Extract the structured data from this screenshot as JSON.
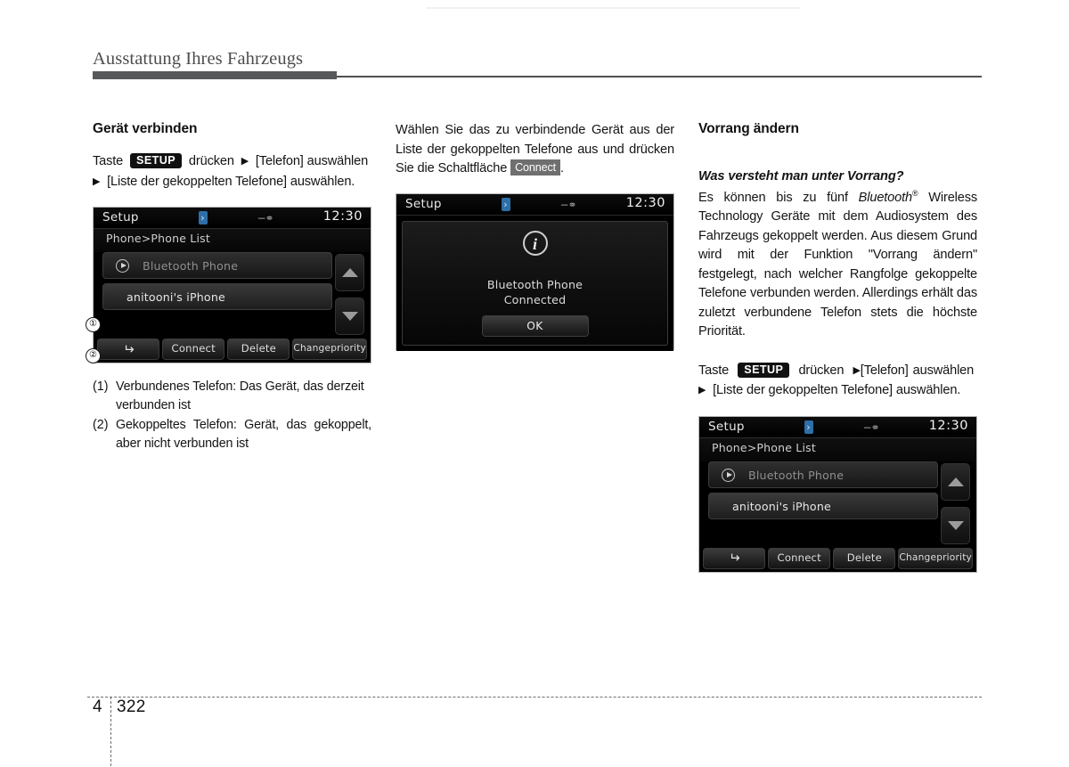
{
  "header": {
    "running_title": "Ausstattung Ihres Fahrzeugs"
  },
  "footer": {
    "chapter": "4",
    "page": "322"
  },
  "columns": {
    "left": {
      "heading": "Gerät verbinden",
      "instruction": {
        "before_key": "Taste",
        "key_label": "SETUP",
        "after_key": "drücken",
        "arrow": "▶",
        "step2": "[Telefon] auswählen",
        "step3": "[Liste der gekoppelten Telefone] auswählen."
      },
      "captions": [
        {
          "marker": "(1)",
          "text": "Verbundenes Telefon: Das Gerät, das derzeit verbunden ist"
        },
        {
          "marker": "(2)",
          "text": "Gekoppeltes Telefon: Gerät, das gekoppelt, aber nicht verbunden ist"
        }
      ],
      "callouts": {
        "one": "①",
        "two": "②"
      }
    },
    "middle": {
      "paragraph_before": "Wählen Sie das zu verbindende Gerät aus der Liste der gekoppelten Telefone aus und drücken Sie die Schaltfläche",
      "inline_button": "Connect",
      "paragraph_after": "."
    },
    "right": {
      "heading": "Vorrang ändern",
      "subheading": "Was versteht man unter Vorrang?",
      "paragraph_part1": "Es können bis zu fünf",
      "brand": "Bluetooth",
      "brand_mark": "®",
      "paragraph_part2": "Wireless Technology Geräte mit dem Audiosystem des Fahrzeugs gekoppelt werden. Aus diesem Grund wird mit der Funktion \"Vorrang ändern\" festgelegt, nach welcher Rangfolge gekoppelte Telefone verbunden werden. Allerdings erhält das zuletzt verbundene Telefon stets die höchste Priorität.",
      "instruction": {
        "before_key": "Taste",
        "key_label": "SETUP",
        "after_key": "drücken",
        "arrow": "▶",
        "step2": "[Telefon] auswählen",
        "step3": "[Liste der gekoppelten Telefone] auswählen."
      }
    }
  },
  "screens": {
    "phone_list": {
      "status": {
        "title": "Setup",
        "clock": "12:30",
        "bluetooth_icon": "bluetooth-icon",
        "usb_icon": "usb-icon"
      },
      "breadcrumb": "Phone>Phone List",
      "items": [
        {
          "label": "Bluetooth Phone",
          "state": "connected",
          "icon": "play-circle-icon"
        },
        {
          "label": "anitooni's iPhone",
          "state": "paired",
          "icon": ""
        }
      ],
      "scroll": {
        "up": "scroll-up-icon",
        "down": "scroll-down-icon"
      },
      "toolbar": [
        {
          "label": "",
          "icon": "back-arrow-icon"
        },
        {
          "label": "Connect",
          "icon": ""
        },
        {
          "label": "Delete",
          "icon": ""
        },
        {
          "label": "Change priority",
          "line1": "Change",
          "line2": "priority",
          "icon": ""
        }
      ]
    },
    "connected_dialog": {
      "status": {
        "title": "Setup",
        "clock": "12:30",
        "bluetooth_icon": "bluetooth-icon",
        "usb_icon": "usb-icon"
      },
      "info_icon": "info-icon",
      "message_line1": "Bluetooth Phone",
      "message_line2": "Connected",
      "ok_label": "OK"
    }
  },
  "colors": {
    "header_rule": "#57585a",
    "key_pill_bg": "#111111",
    "inline_button_bg": "#6f6f6f",
    "screen_bg": "#000000",
    "bluetooth_icon": "#2e6fa8"
  }
}
